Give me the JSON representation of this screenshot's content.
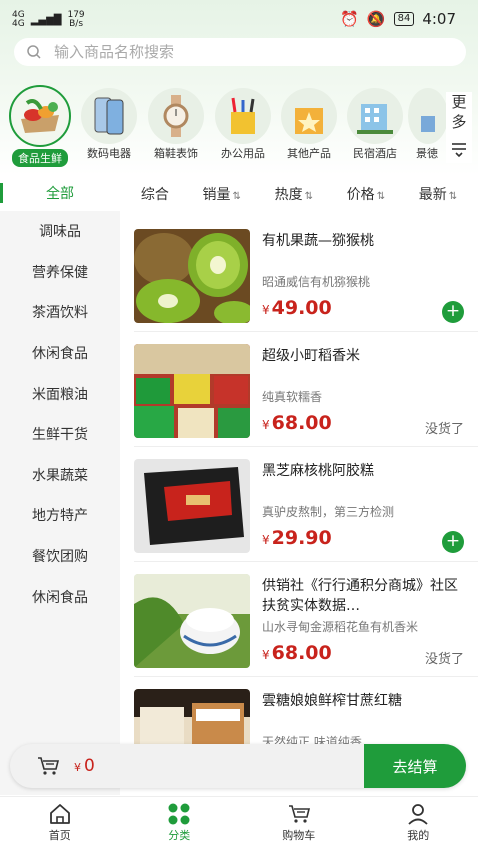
{
  "status": {
    "net_top": "4G",
    "net_bottom": "4G",
    "speed": "179",
    "speed_unit": "B/s",
    "battery": "84",
    "time": "4:07"
  },
  "search": {
    "placeholder": "输入商品名称搜索"
  },
  "categories": [
    {
      "label": "食品生鲜",
      "icon": "food-fresh-icon"
    },
    {
      "label": "数码电器",
      "icon": "phone-icon"
    },
    {
      "label": "箱鞋表饰",
      "icon": "watch-icon"
    },
    {
      "label": "办公用品",
      "icon": "stationery-icon"
    },
    {
      "label": "其他产品",
      "icon": "box-star-icon"
    },
    {
      "label": "民宿酒店",
      "icon": "hotel-icon"
    },
    {
      "label": "景徳",
      "icon": "scenic-icon"
    }
  ],
  "more": {
    "line1": "更",
    "line2": "多"
  },
  "sidebar": {
    "all": "全部",
    "items": [
      "调味品",
      "营养保健",
      "茶酒饮料",
      "休闲食品",
      "米面粮油",
      "生鲜干货",
      "水果蔬菜",
      "地方特产",
      "餐饮团购",
      "休闲食品"
    ]
  },
  "sorts": [
    "综合",
    "销量",
    "热度",
    "价格",
    "最新"
  ],
  "currency": "¥",
  "products": [
    {
      "name": "有机果蔬—猕猴桃",
      "desc": "昭通威信有机猕猴桃",
      "price": "49.00",
      "status": "add"
    },
    {
      "name": "超级小町稻香米",
      "desc": "纯真软糯香",
      "price": "68.00",
      "status": "没货了"
    },
    {
      "name": "黑芝麻核桃阿胶糕",
      "desc": "真驴皮熬制，第三方检测",
      "price": "29.90",
      "status": "add"
    },
    {
      "name": "供销社《行行通积分商城》社区扶贫实体数据…",
      "desc": "山水寻甸金源稻花鱼有机香米",
      "price": "68.00",
      "status": "没货了"
    },
    {
      "name": "雲糖娘娘鲜榨甘蔗红糖",
      "desc": "天然纯正 味道纯香",
      "price": "",
      "status": ""
    }
  ],
  "cart": {
    "total": "0",
    "checkout": "去结算"
  },
  "nav": [
    {
      "label": "首页",
      "icon": "home-icon"
    },
    {
      "label": "分类",
      "icon": "category-icon"
    },
    {
      "label": "购物车",
      "icon": "cart-icon"
    },
    {
      "label": "我的",
      "icon": "user-icon"
    }
  ],
  "colors": {
    "accent": "#1f9c3b",
    "price": "#c8231c"
  }
}
